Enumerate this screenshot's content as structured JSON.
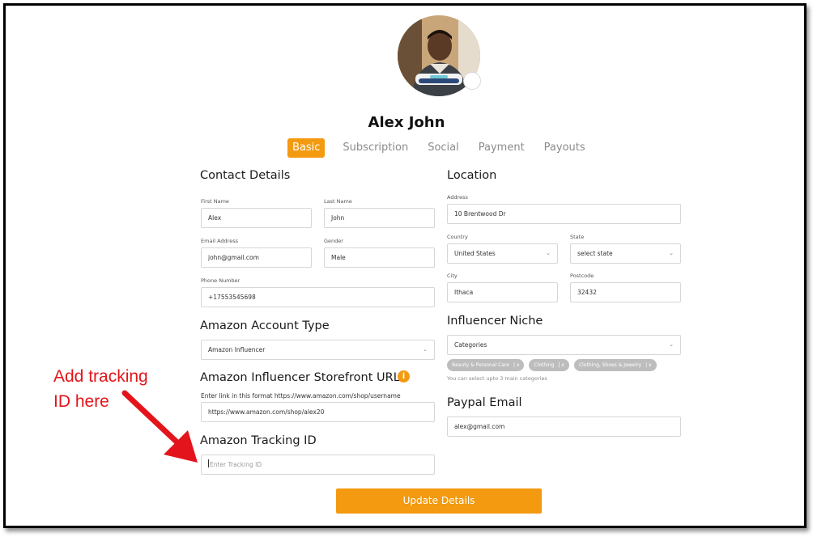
{
  "profile": {
    "name": "Alex John",
    "avatar_icon": "person-photo-avatar"
  },
  "tabs": [
    {
      "label": "Basic",
      "active": true
    },
    {
      "label": "Subscription",
      "active": false
    },
    {
      "label": "Social",
      "active": false
    },
    {
      "label": "Payment",
      "active": false
    },
    {
      "label": "Payouts",
      "active": false
    }
  ],
  "contact": {
    "title": "Contact Details",
    "first_name": {
      "label": "First Name",
      "value": "Alex"
    },
    "last_name": {
      "label": "Last Name",
      "value": "John"
    },
    "email": {
      "label": "Email Address",
      "value": "john@gmail.com"
    },
    "gender": {
      "label": "Gender",
      "value": "Male"
    },
    "phone": {
      "label": "Phone Number",
      "value": "+17553545698"
    }
  },
  "amazon_account": {
    "title": "Amazon Account Type",
    "value": "Amazon Influencer"
  },
  "storefront": {
    "title": "Amazon Influencer Storefront URL",
    "hint": "Enter link in this format https://www.amazon.com/shop/username",
    "value": "https://www.amazon.com/shop/alex20",
    "info_icon": "info-icon"
  },
  "tracking": {
    "title": "Amazon Tracking ID",
    "placeholder": "Enter Tracking ID"
  },
  "location": {
    "title": "Location",
    "address": {
      "label": "Address",
      "value": "10 Brentwood Dr"
    },
    "country": {
      "label": "Country",
      "value": "United States"
    },
    "state": {
      "label": "State",
      "value": "select state"
    },
    "city": {
      "label": "City",
      "value": "Ithaca"
    },
    "postcode": {
      "label": "Postcode",
      "value": "32432"
    }
  },
  "niche": {
    "title": "Influencer Niche",
    "placeholder": "Categories",
    "chips": [
      {
        "label": "Beauty & Personal Care",
        "x": "| x"
      },
      {
        "label": "Clothing",
        "x": "| x"
      },
      {
        "label": "Clothing, Shoes & Jewelry",
        "x": "| x"
      }
    ],
    "hint": "You can select upto 3 main categories"
  },
  "paypal": {
    "title": "Paypal Email",
    "value": "alex@gmail.com"
  },
  "actions": {
    "update_label": "Update Details"
  },
  "annotation": {
    "line1": "Add tracking",
    "line2": "ID here",
    "color": "#e3141b"
  },
  "colors": {
    "accent": "#f39a10"
  }
}
